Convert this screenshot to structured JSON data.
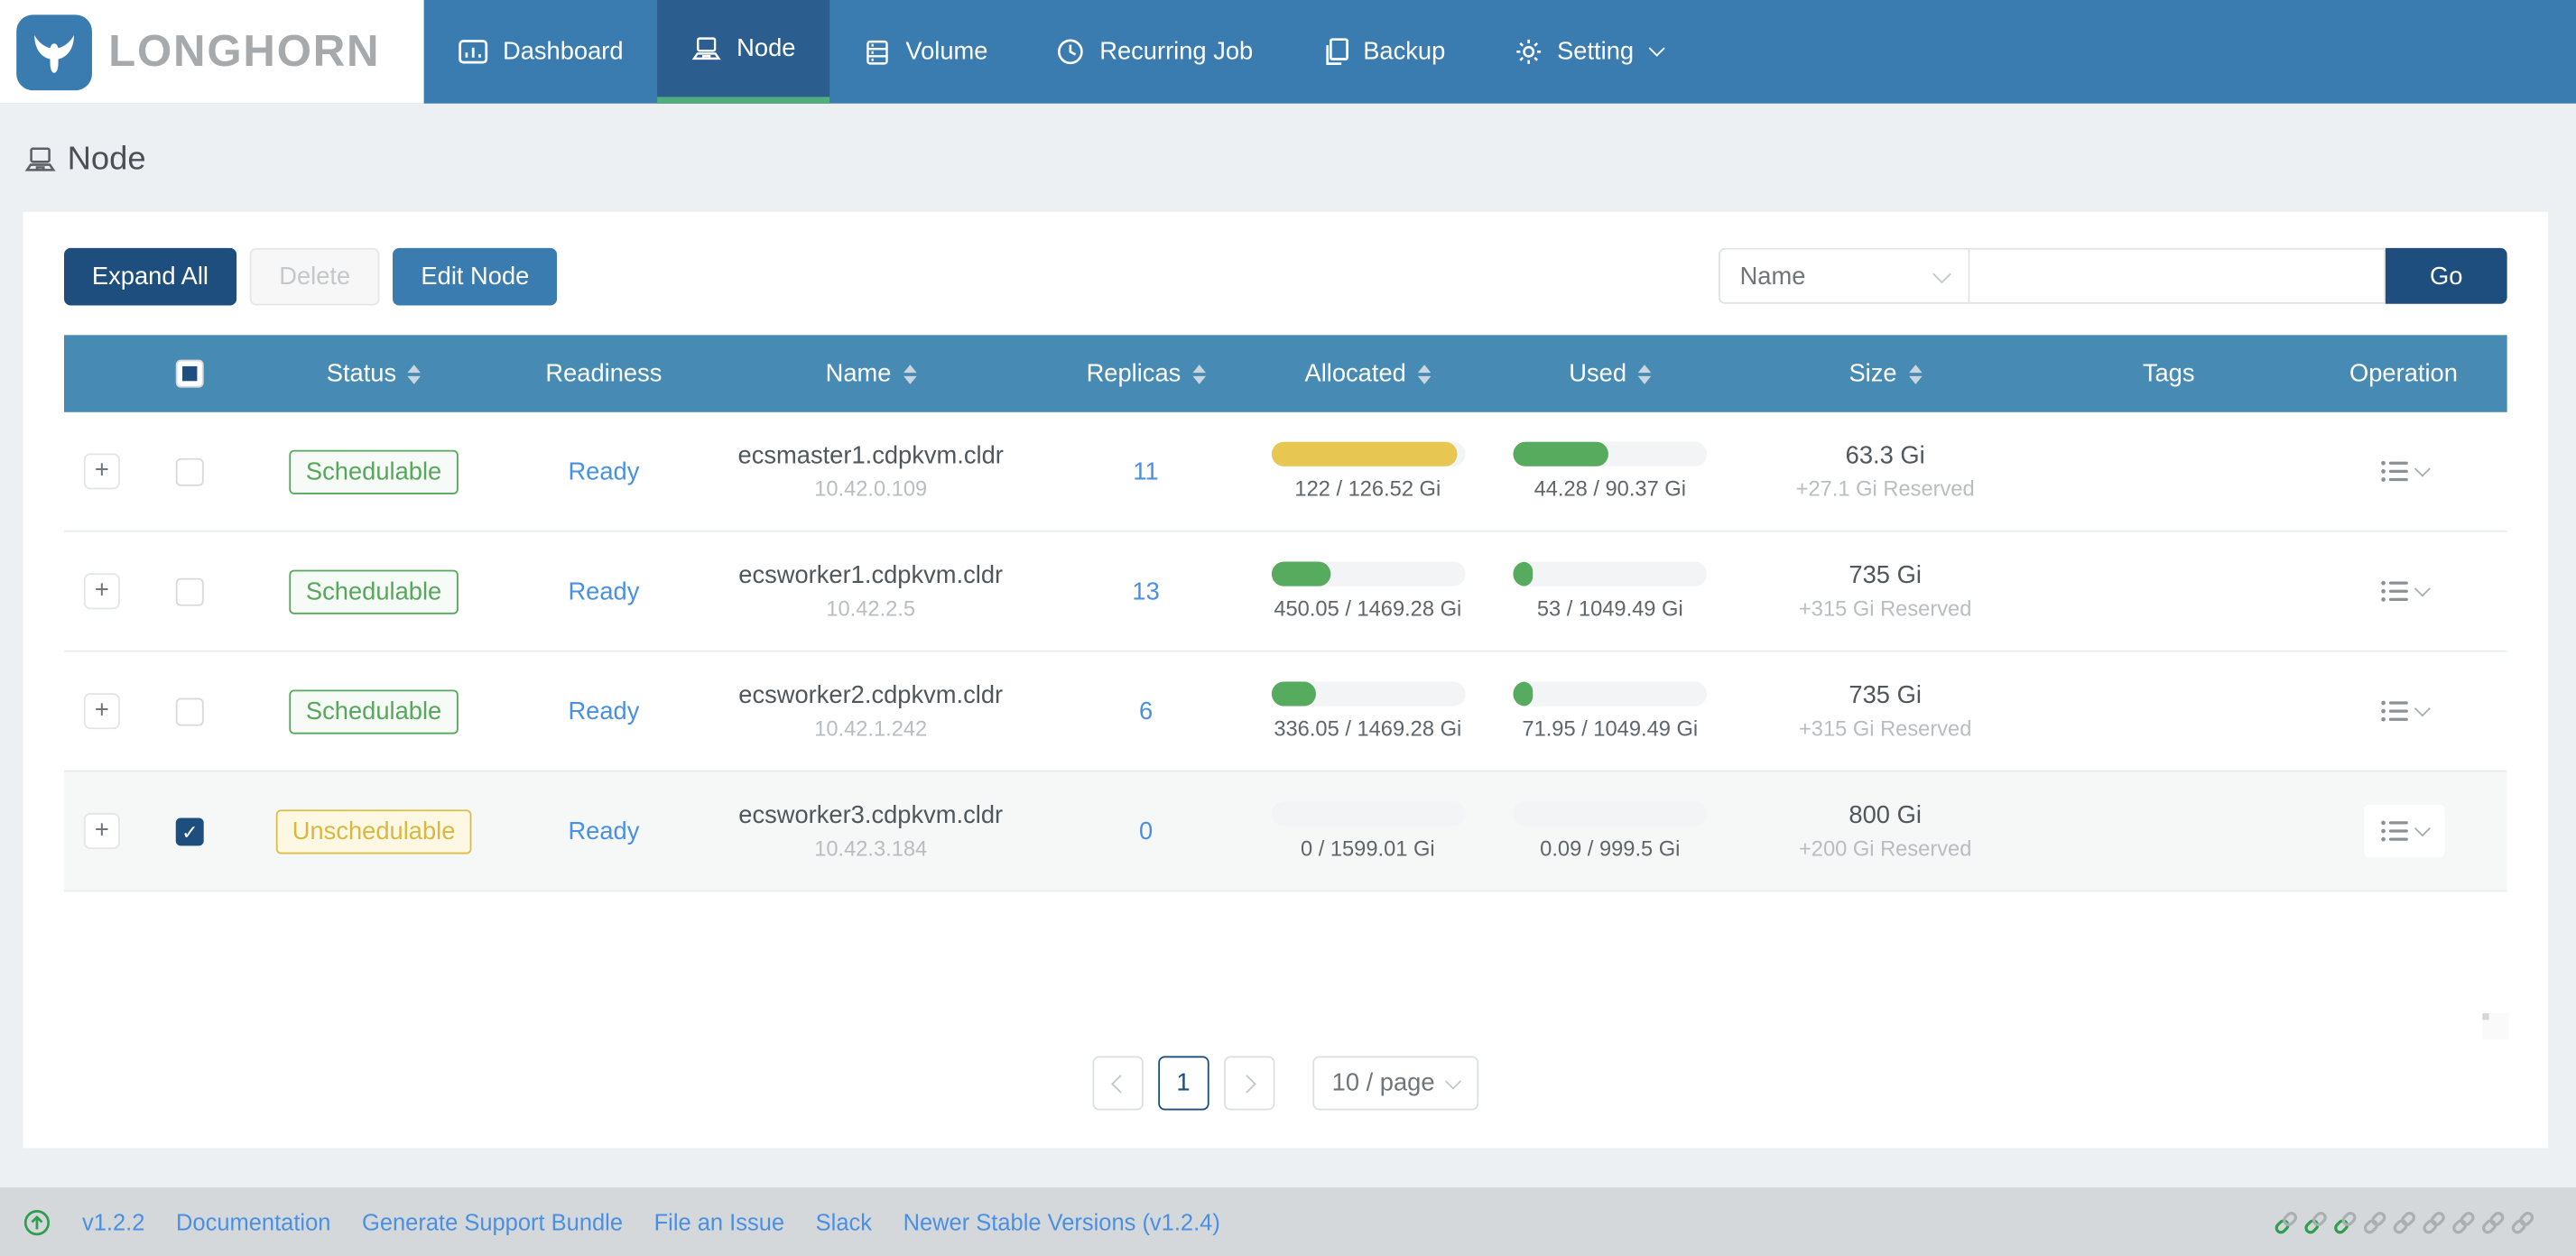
{
  "brand": {
    "name": "LONGHORN"
  },
  "nav": {
    "items": [
      {
        "label": "Dashboard",
        "icon": "dashboard",
        "active": false
      },
      {
        "label": "Node",
        "icon": "node",
        "active": true
      },
      {
        "label": "Volume",
        "icon": "volume",
        "active": false
      },
      {
        "label": "Recurring Job",
        "icon": "clock",
        "active": false
      },
      {
        "label": "Backup",
        "icon": "backup",
        "active": false
      },
      {
        "label": "Setting",
        "icon": "gear",
        "active": false,
        "has_dropdown": true
      }
    ]
  },
  "page": {
    "title": "Node"
  },
  "toolbar": {
    "expand_all_label": "Expand All",
    "delete_label": "Delete",
    "edit_node_label": "Edit Node",
    "search_field_selected": "Name",
    "search_value": "",
    "go_label": "Go"
  },
  "table": {
    "expand_label": "+",
    "columns": [
      {
        "label": "Status",
        "sortable": true
      },
      {
        "label": "Readiness",
        "sortable": false
      },
      {
        "label": "Name",
        "sortable": true
      },
      {
        "label": "Replicas",
        "sortable": true
      },
      {
        "label": "Allocated",
        "sortable": true
      },
      {
        "label": "Used",
        "sortable": true
      },
      {
        "label": "Size",
        "sortable": true
      },
      {
        "label": "Tags",
        "sortable": false
      },
      {
        "label": "Operation",
        "sortable": false
      }
    ],
    "rows": [
      {
        "status": "Schedulable",
        "status_type": "schedulable",
        "readiness": "Ready",
        "name": "ecsmaster1.cdpkvm.cldr",
        "ip": "10.42.0.109",
        "replicas": "11",
        "checked": false,
        "selected": false,
        "allocated": {
          "label": "122 / 126.52 Gi",
          "percent": 96,
          "color": "yellow"
        },
        "used": {
          "label": "44.28 / 90.37 Gi",
          "percent": 49,
          "color": "green"
        },
        "size": "63.3 Gi",
        "reserved": "+27.1 Gi Reserved",
        "tags": ""
      },
      {
        "status": "Schedulable",
        "status_type": "schedulable",
        "readiness": "Ready",
        "name": "ecsworker1.cdpkvm.cldr",
        "ip": "10.42.2.5",
        "replicas": "13",
        "checked": false,
        "selected": false,
        "allocated": {
          "label": "450.05 / 1469.28 Gi",
          "percent": 31,
          "color": "green"
        },
        "used": {
          "label": "53 / 1049.49 Gi",
          "percent": 6,
          "color": "green"
        },
        "size": "735 Gi",
        "reserved": "+315 Gi Reserved",
        "tags": ""
      },
      {
        "status": "Schedulable",
        "status_type": "schedulable",
        "readiness": "Ready",
        "name": "ecsworker2.cdpkvm.cldr",
        "ip": "10.42.1.242",
        "replicas": "6",
        "checked": false,
        "selected": false,
        "allocated": {
          "label": "336.05 / 1469.28 Gi",
          "percent": 23,
          "color": "green"
        },
        "used": {
          "label": "71.95 / 1049.49 Gi",
          "percent": 7,
          "color": "green"
        },
        "size": "735 Gi",
        "reserved": "+315 Gi Reserved",
        "tags": ""
      },
      {
        "status": "Unschedulable",
        "status_type": "unschedulable",
        "readiness": "Ready",
        "name": "ecsworker3.cdpkvm.cldr",
        "ip": "10.42.3.184",
        "replicas": "0",
        "checked": true,
        "selected": true,
        "allocated": {
          "label": "0 / 1599.01 Gi",
          "percent": 0,
          "color": "green"
        },
        "used": {
          "label": "0.09 / 999.5 Gi",
          "percent": 0,
          "color": "green"
        },
        "size": "800 Gi",
        "reserved": "+200 Gi Reserved",
        "tags": ""
      }
    ]
  },
  "pagination": {
    "current_page": "1",
    "page_size_label": "10 / page"
  },
  "footer": {
    "version": "v1.2.2",
    "links": [
      "Documentation",
      "Generate Support Bundle",
      "File an Issue",
      "Slack",
      "Newer Stable Versions (v1.2.4)"
    ],
    "status_links": {
      "green": 3,
      "total": 9
    }
  },
  "colors": {
    "nav": "#3B7CB0",
    "nav_active": "#2B5E8E",
    "active_underline": "#4FAE7C",
    "table_header": "#478BB5",
    "accent_dark": "#1E4E7E",
    "link_blue": "#4A90E2",
    "yellow": "#E7C651",
    "green": "#57AB5E",
    "schedulable": "#57A75B",
    "unschedulable": "#D8B840",
    "footer_bg": "#D5D8DA",
    "status_link_green": "#2E9E4F",
    "status_link_gray": "#ABAFB2"
  }
}
